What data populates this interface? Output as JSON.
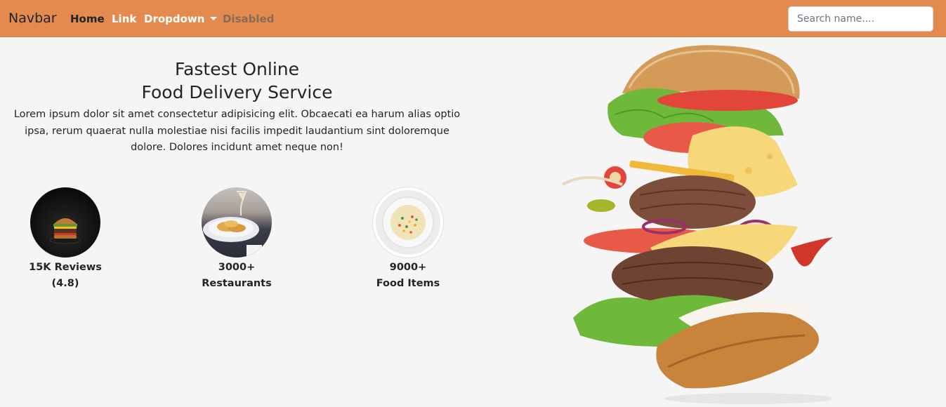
{
  "navbar": {
    "brand": "Navbar",
    "links": [
      "Home",
      "Link",
      "Dropdown",
      "Disabled"
    ],
    "accent_color": "#e38b4f"
  },
  "search": {
    "placeholder": "Search name...."
  },
  "hero": {
    "title_line1": "Fastest Online",
    "title_line2": "Food Delivery Service",
    "description": "Lorem ipsum dolor sit amet consectetur adipisicing elit. Obcaecati ea harum alias optio ipsa, rerum quaerat nulla molestiae nisi facilis impedit laudantium sint doloremque dolore. Dolores incidunt amet neque non!"
  },
  "stats": [
    {
      "line1": "15K Reviews",
      "line2": "(4.8)",
      "image": "burger-photo"
    },
    {
      "line1": "3000+",
      "line2": "Restaurants",
      "image": "fish-plate-photo"
    },
    {
      "line1": "9000+",
      "line2": "Food Items",
      "image": "fried-rice-photo"
    }
  ],
  "hero_image": "flying-burger-photo"
}
